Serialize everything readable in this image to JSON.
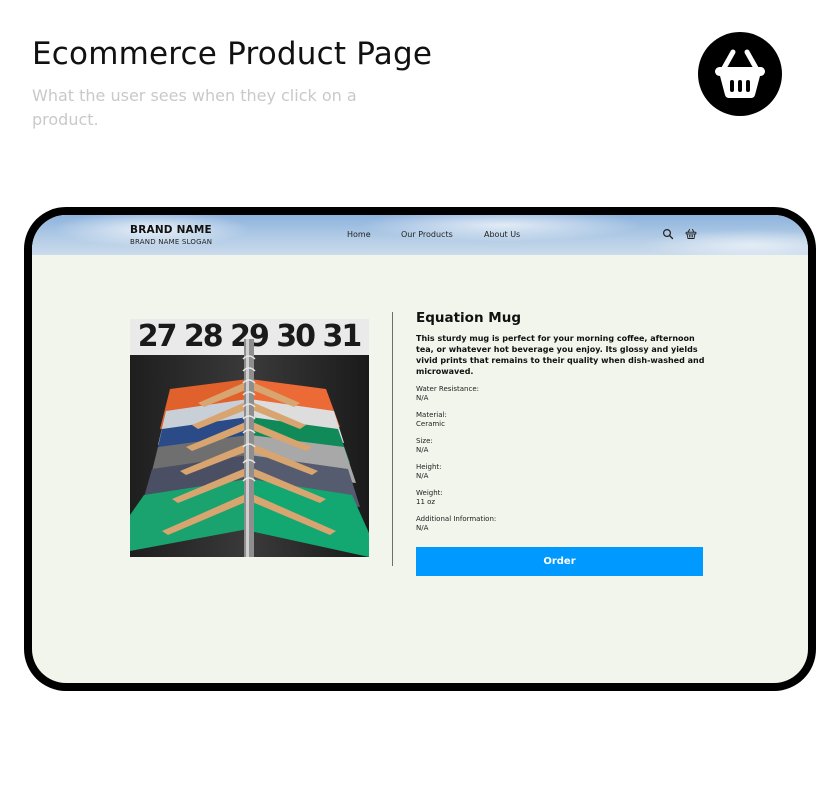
{
  "header": {
    "title": "Ecommerce Product Page",
    "subtitle": "What the user sees when they click on a product."
  },
  "badge": {
    "icon": "basket-icon"
  },
  "navbar": {
    "brand_name": "BRAND NAME",
    "brand_slogan": "BRAND NAME SLOGAN",
    "links": [
      "Home",
      "Our Products",
      "About Us"
    ],
    "icons": [
      "search-icon",
      "basket-icon"
    ]
  },
  "product": {
    "image": {
      "visible_text": "27 28 29 30 31"
    },
    "title": "Equation Mug",
    "description": "This sturdy mug is perfect for your morning coffee, afternoon tea, or whatever hot beverage you enjoy. Its glossy and yields vivid prints that remains to their quality when dish-washed and microwaved.",
    "specs": [
      {
        "label": "Water Resistance:",
        "value": "N/A"
      },
      {
        "label": "Material:",
        "value": "Ceramic"
      },
      {
        "label": "Size:",
        "value": "N/A"
      },
      {
        "label": "Height:",
        "value": "N/A"
      },
      {
        "label": "Weight:",
        "value": "11 oz"
      },
      {
        "label": "Additional Information:",
        "value": "N/A"
      }
    ],
    "order_label": "Order"
  },
  "colors": {
    "accent": "#0099ff",
    "screen_bg": "#f1f5ec",
    "frame": "#000000"
  }
}
